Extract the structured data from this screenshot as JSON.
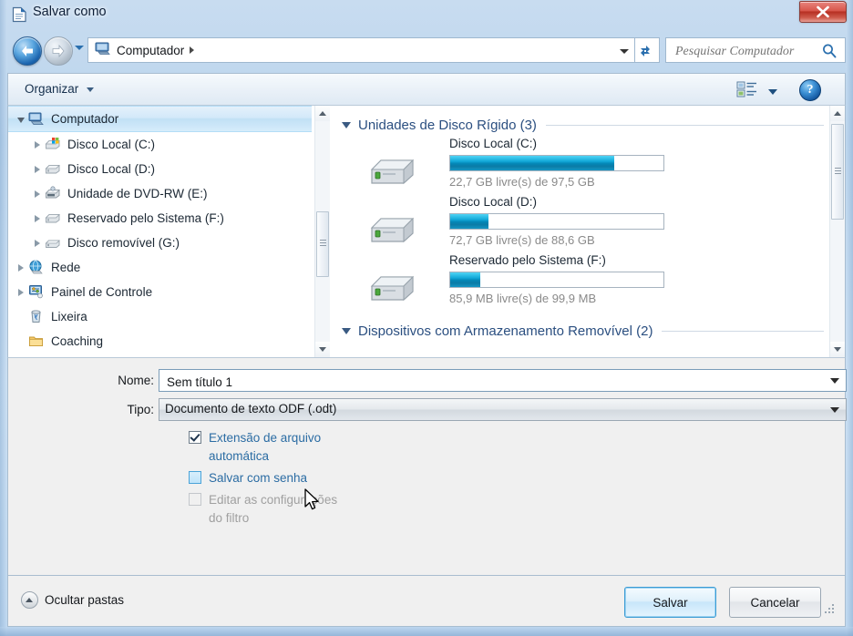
{
  "window": {
    "title": "Salvar como",
    "title_icon": "document-icon",
    "close_label": "x"
  },
  "nav": {
    "back_icon": "back-arrow-icon",
    "forward_icon": "forward-arrow-icon",
    "history_icon": "chevron-down-icon",
    "refresh_icon": "refresh-icon",
    "address_icon": "computer-icon",
    "breadcrumbs": [
      "Computador"
    ],
    "search": {
      "placeholder": "Pesquisar Computador",
      "value": "",
      "icon": "search-icon"
    }
  },
  "toolbar": {
    "organize_label": "Organizar",
    "view_icon": "view-mode-icon",
    "help_icon": "help-icon",
    "help_label": "?"
  },
  "sidebar": {
    "items": [
      {
        "label": "Computador",
        "icon": "computer-icon",
        "indent": 0,
        "twisty": "expanded",
        "selected": true
      },
      {
        "label": "Disco Local (C:)",
        "icon": "drive-windows-icon",
        "indent": 1,
        "twisty": "collapsed",
        "selected": false
      },
      {
        "label": "Disco Local (D:)",
        "icon": "drive-icon",
        "indent": 1,
        "twisty": "collapsed",
        "selected": false
      },
      {
        "label": "Unidade de DVD-RW (E:)",
        "icon": "dvd-drive-icon",
        "indent": 1,
        "twisty": "collapsed",
        "selected": false
      },
      {
        "label": "Reservado pelo Sistema (F:)",
        "icon": "drive-icon",
        "indent": 1,
        "twisty": "collapsed",
        "selected": false
      },
      {
        "label": "Disco removível (G:)",
        "icon": "removable-drive-icon",
        "indent": 1,
        "twisty": "collapsed",
        "selected": false
      },
      {
        "label": "Rede",
        "icon": "network-icon",
        "indent": 0,
        "twisty": "collapsed",
        "selected": false
      },
      {
        "label": "Painel de Controle",
        "icon": "control-panel-icon",
        "indent": 0,
        "twisty": "collapsed",
        "selected": false
      },
      {
        "label": "Lixeira",
        "icon": "recycle-bin-icon",
        "indent": 0,
        "twisty": "none",
        "selected": false
      },
      {
        "label": "Coaching",
        "icon": "folder-icon",
        "indent": 0,
        "twisty": "none",
        "selected": false
      }
    ]
  },
  "content": {
    "groups": [
      {
        "title": "Unidades de Disco Rígido (3)",
        "drives": [
          {
            "name": "Disco Local (C:)",
            "free": "22,7 GB",
            "total": "97,5 GB",
            "usage_text": "22,7 GB livre(s) de 97,5 GB",
            "used_percent": 77
          },
          {
            "name": "Disco Local (D:)",
            "free": "72,7 GB",
            "total": "88,6 GB",
            "usage_text": "72,7 GB livre(s) de 88,6 GB",
            "used_percent": 18
          },
          {
            "name": "Reservado pelo Sistema (F:)",
            "free": "85,9 MB",
            "total": "99,9 MB",
            "usage_text": "85,9 MB livre(s) de 99,9 MB",
            "used_percent": 14
          }
        ]
      },
      {
        "title": "Dispositivos com Armazenamento Removível (2)",
        "drives": []
      }
    ]
  },
  "form": {
    "name_label": "Nome:",
    "name_value": "Sem título 1",
    "type_label": "Tipo:",
    "type_value": "Documento de texto ODF (.odt)",
    "options": [
      {
        "label": "Extensão de arquivo automática",
        "state": "checked"
      },
      {
        "label": "Salvar com senha",
        "state": "hover"
      },
      {
        "label": "Editar as configurações do filtro",
        "state": "disabled"
      }
    ]
  },
  "bottom": {
    "hide_folders_label": "Ocultar pastas",
    "hide_folders_icon": "chevron-up-circle-icon",
    "save_label": "Salvar",
    "cancel_label": "Cancelar"
  }
}
